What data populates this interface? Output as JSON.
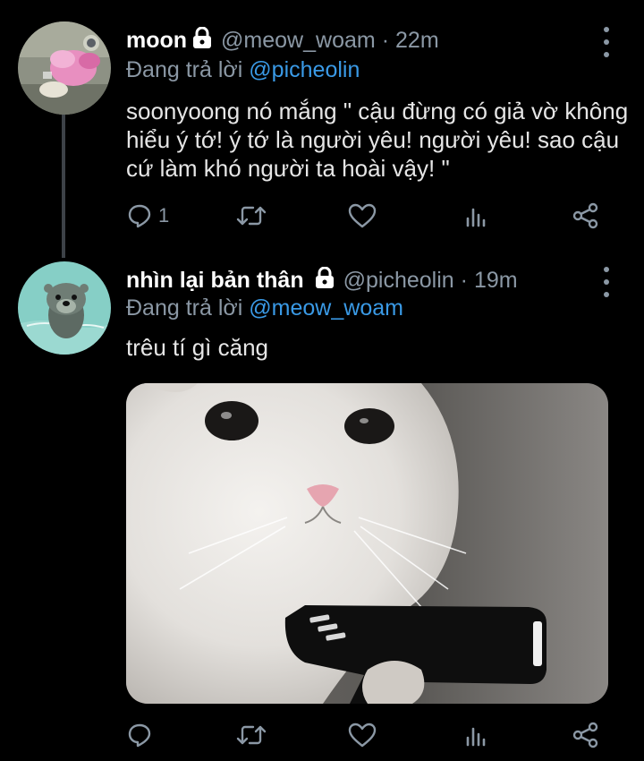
{
  "tweets": [
    {
      "name": "moon",
      "handle": "@meow_woam",
      "time": "22m",
      "reply_prefix": "Đang trả lời",
      "reply_to": "@picheolin",
      "text": "soonyoong nó mắng \" cậu đừng có giả vờ không hiểu ý tớ! ý tớ là người yêu! người yêu! sao cậu cứ làm khó người ta hoài vậy! \"",
      "reply_count": "1"
    },
    {
      "name": "nhìn lại bản thân",
      "handle": "@picheolin",
      "time": "19m",
      "reply_prefix": "Đang trả lời",
      "reply_to": "@meow_woam",
      "text": "trêu tí gì căng",
      "reply_count": ""
    }
  ],
  "separator": "·",
  "icons": [
    "lock-icon",
    "more-vertical-icon",
    "reply-icon",
    "retweet-icon",
    "like-icon",
    "analytics-icon",
    "share-icon"
  ],
  "colors": {
    "background": "#000000",
    "mention": "#3a9ae6",
    "muted": "#8b98a5",
    "text": "#e6e6e6"
  }
}
